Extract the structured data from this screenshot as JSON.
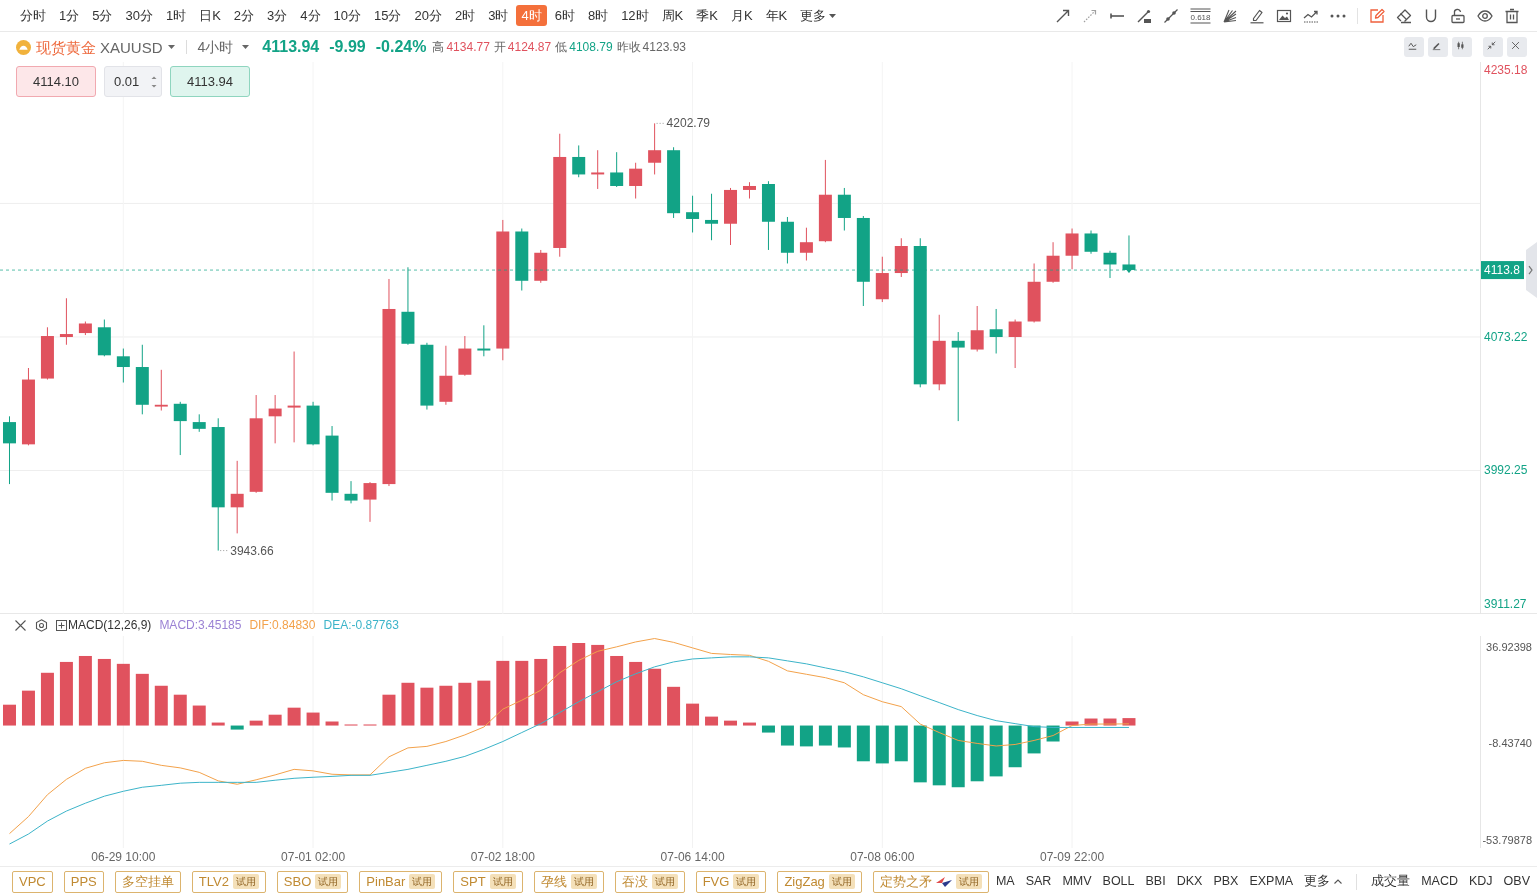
{
  "toolbar": {
    "intervals": [
      {
        "label": "分时",
        "selected": false
      },
      {
        "label": "1分",
        "selected": false
      },
      {
        "label": "5分",
        "selected": false
      },
      {
        "label": "30分",
        "selected": false
      },
      {
        "label": "1时",
        "selected": false
      },
      {
        "label": "日K",
        "selected": false
      },
      {
        "label": "2分",
        "selected": false
      },
      {
        "label": "3分",
        "selected": false
      },
      {
        "label": "4分",
        "selected": false
      },
      {
        "label": "10分",
        "selected": false
      },
      {
        "label": "15分",
        "selected": false
      },
      {
        "label": "20分",
        "selected": false
      },
      {
        "label": "2时",
        "selected": false
      },
      {
        "label": "3时",
        "selected": false
      },
      {
        "label": "4时",
        "selected": true
      },
      {
        "label": "6时",
        "selected": false
      },
      {
        "label": "8时",
        "selected": false
      },
      {
        "label": "12时",
        "selected": false
      },
      {
        "label": "周K",
        "selected": false
      },
      {
        "label": "季K",
        "selected": false
      },
      {
        "label": "月K",
        "selected": false
      },
      {
        "label": "年K",
        "selected": false
      }
    ],
    "more": "更多",
    "drawing_tools": [
      {
        "selected": false
      },
      {
        "selected": false
      },
      {
        "selected": false
      },
      {
        "selected": false
      },
      {
        "selected": false
      },
      {
        "selected": false,
        "label": "0.618"
      },
      {
        "selected": false
      },
      {
        "selected": false
      },
      {
        "selected": false
      },
      {
        "selected": false
      }
    ],
    "edit_tools": [
      {
        "selected": true
      },
      {
        "selected": false
      },
      {
        "selected": false
      },
      {
        "selected": false
      },
      {
        "selected": false
      },
      {
        "selected": false
      }
    ]
  },
  "header": {
    "symbol": {
      "name": "现货黄金",
      "code": "XAUUSD"
    },
    "period": "4小时",
    "quote": {
      "price": "4113.94",
      "change": "-9.99",
      "change_percent": "-0.24%",
      "rising": false
    },
    "stats": [
      {
        "label": "高",
        "value": "4134.77",
        "color": "#e0525e"
      },
      {
        "label": "开",
        "value": "4124.87",
        "color": "#e0525e"
      },
      {
        "label": "低",
        "value": "4108.79",
        "color": "#12a386"
      },
      {
        "label": "昨收",
        "value": "4123.93",
        "color": "#666666"
      }
    ]
  },
  "trade": {
    "sell_price": "4114.10",
    "lot": "0.01",
    "buy_price": "4113.94"
  },
  "chart": {
    "chart_data": [
      {
        "type": "candlestick",
        "ylim": [
          3905.2,
          4240.0
        ],
        "yticks": [
          4235.18,
          4073.22,
          3992.25,
          3911.27
        ],
        "grid": true,
        "annotations": [
          "4202.79",
          "3943.66"
        ],
        "ref_lines": [
          {
            "axis": "y",
            "value": 4113.8,
            "label": "4113.8",
            "color": "#12a386",
            "line_style": "dashed"
          }
        ],
        "ohlc": [
          [
            4021.6,
            4025.1,
            3984.0,
            4008.7
          ],
          [
            4008.1,
            4054.4,
            4007.5,
            4047.4
          ],
          [
            4048.0,
            4079.1,
            4047.4,
            4073.8
          ],
          [
            4073.2,
            4096.7,
            4068.5,
            4075.0
          ],
          [
            4075.6,
            4082.6,
            4074.4,
            4081.4
          ],
          [
            4079.1,
            4083.8,
            4061.5,
            4062.1
          ],
          [
            4061.5,
            4066.2,
            4045.6,
            4055.0
          ],
          [
            4055.0,
            4068.5,
            4026.3,
            4032.1
          ],
          [
            4031.0,
            4053.3,
            4028.6,
            4032.1
          ],
          [
            4032.7,
            4033.9,
            4001.6,
            4022.2
          ],
          [
            4021.6,
            4026.3,
            4015.7,
            4017.5
          ],
          [
            4018.6,
            4023.9,
            3943.66,
            3969.9
          ],
          [
            3969.9,
            3998.1,
            3954.1,
            3978.1
          ],
          [
            3979.3,
            4038.0,
            3978.7,
            4023.9
          ],
          [
            4025.1,
            4038.0,
            4008.7,
            4029.8
          ],
          [
            4030.4,
            4064.4,
            4009.3,
            4031.6
          ],
          [
            4031.6,
            4033.9,
            4007.5,
            4008.1
          ],
          [
            4013.4,
            4019.2,
            3974.0,
            3978.7
          ],
          [
            3978.1,
            3985.8,
            3972.3,
            3974.0
          ],
          [
            3974.6,
            3985.2,
            3961.1,
            3984.6
          ],
          [
            3984.0,
            4108.4,
            3982.8,
            4090.2
          ],
          [
            4088.5,
            4115.5,
            4068.5,
            4069.1
          ],
          [
            4068.5,
            4069.7,
            4029.2,
            4031.6
          ],
          [
            4033.9,
            4067.9,
            4032.1,
            4049.7
          ],
          [
            4050.3,
            4073.8,
            4049.7,
            4066.2
          ],
          [
            4066.2,
            4080.3,
            4061.5,
            4065.0
          ],
          [
            4066.2,
            4144.2,
            4059.1,
            4137.2
          ],
          [
            4137.2,
            4139.0,
            4101.4,
            4107.3
          ],
          [
            4107.3,
            4126.0,
            4106.1,
            4124.3
          ],
          [
            4127.2,
            4196.5,
            4121.9,
            4182.4
          ],
          [
            4182.4,
            4189.4,
            4170.1,
            4171.8
          ],
          [
            4171.8,
            4186.5,
            4163.0,
            4173.0
          ],
          [
            4173.0,
            4185.3,
            4164.2,
            4164.8
          ],
          [
            4164.8,
            4178.9,
            4157.2,
            4175.3
          ],
          [
            4178.9,
            4202.79,
            4171.8,
            4186.5
          ],
          [
            4186.5,
            4188.3,
            4145.4,
            4148.3
          ],
          [
            4148.9,
            4158.9,
            4136.6,
            4144.8
          ],
          [
            4144.2,
            4160.1,
            4131.9,
            4141.9
          ],
          [
            4141.9,
            4163.6,
            4129.0,
            4162.4
          ],
          [
            4162.4,
            4167.1,
            4157.2,
            4164.8
          ],
          [
            4166.0,
            4167.7,
            4126.0,
            4143.1
          ],
          [
            4143.1,
            4146.0,
            4117.8,
            4124.3
          ],
          [
            4124.3,
            4139.5,
            4119.6,
            4130.7
          ],
          [
            4131.3,
            4180.6,
            4130.7,
            4159.5
          ],
          [
            4159.5,
            4163.6,
            4137.8,
            4145.4
          ],
          [
            4145.4,
            4146.6,
            4092.0,
            4106.7
          ],
          [
            4096.1,
            4121.9,
            4094.4,
            4112.0
          ],
          [
            4112.0,
            4133.1,
            4109.6,
            4128.4
          ],
          [
            4128.4,
            4133.1,
            4042.7,
            4044.5
          ],
          [
            4044.5,
            4086.7,
            4040.9,
            4070.9
          ],
          [
            4070.9,
            4076.2,
            4022.2,
            4066.8
          ],
          [
            4065.6,
            4092.0,
            4064.4,
            4077.3
          ],
          [
            4077.9,
            4090.2,
            4063.2,
            4073.2
          ],
          [
            4073.2,
            4083.8,
            4054.4,
            4082.6
          ],
          [
            4082.6,
            4117.8,
            4082.0,
            4106.7
          ],
          [
            4106.7,
            4130.7,
            4106.1,
            4122.5
          ],
          [
            4122.5,
            4139.0,
            4114.3,
            4136.0
          ],
          [
            4136.0,
            4137.8,
            4123.7,
            4124.9
          ],
          [
            4124.3,
            4125.5,
            4109.0,
            4117.2
          ],
          [
            4117.2,
            4134.8,
            4112.5,
            4113.87
          ],
          null,
          null,
          null,
          null,
          null,
          null,
          null,
          null,
          null,
          null,
          null,
          null,
          null,
          null,
          null,
          null,
          null,
          null
        ]
      },
      {
        "type": "bar",
        "title": "MACD(12,26,9)",
        "ylim": [
          -57.56,
          42.09
        ],
        "grid": true,
        "yticks": [
          {
            "value": 36.92398,
            "label": "36.92398"
          },
          {
            "value": -8.4374,
            "label": "-8.43740"
          },
          {
            "value": -53.79878,
            "label": "-53.79878"
          }
        ],
        "categories": [
          null,
          null,
          null,
          null,
          null,
          null,
          "06-29 10:00",
          null,
          null,
          null,
          null,
          null,
          null,
          null,
          null,
          null,
          "07-01 02:00",
          null,
          null,
          null,
          null,
          null,
          null,
          null,
          null,
          null,
          "07-02 18:00",
          null,
          null,
          null,
          null,
          null,
          null,
          null,
          null,
          null,
          "07-06 14:00",
          null,
          null,
          null,
          null,
          null,
          null,
          null,
          null,
          null,
          "07-08 06:00",
          null,
          null,
          null,
          null,
          null,
          null,
          null,
          null,
          null,
          "07-09 22:00",
          null,
          null,
          null,
          null,
          null,
          null,
          null,
          null,
          null,
          null,
          null,
          null,
          null,
          null,
          null,
          null,
          null,
          null,
          null,
          null,
          null
        ],
        "series": [
          {
            "values": [
              9.8,
              16.4,
              24.8,
              29.9,
              32.7,
              31.3,
              29.0,
              24.3,
              18.7,
              14.5,
              9.4,
              1.4,
              -1.9,
              2.3,
              5.1,
              8.4,
              6.1,
              1.9,
              0.5,
              0.5,
              14.5,
              20.1,
              17.8,
              18.7,
              20.1,
              21.1,
              30.4,
              30.4,
              31.3,
              37.4,
              38.8,
              37.9,
              32.7,
              29.9,
              26.7,
              18.2,
              10.3,
              4.2,
              2.3,
              1.4,
              -3.3,
              -9.4,
              -9.8,
              -9.4,
              -10.3,
              -16.8,
              -17.8,
              -16.8,
              -26.7,
              -28.1,
              -29.0,
              -26.2,
              -23.9,
              -19.6,
              -13.1,
              -7.5,
              1.9,
              3.3,
              3.3,
              3.5,
              null,
              null,
              null,
              null,
              null,
              null,
              null,
              null,
              null,
              null,
              null,
              null,
              null,
              null,
              null,
              null,
              null,
              null
            ],
            "colors": [
              "#e0525e",
              "#e0525e",
              "#e0525e",
              "#e0525e",
              "#e0525e",
              "#e0525e",
              "#e0525e",
              "#e0525e",
              "#e0525e",
              "#e0525e",
              "#e0525e",
              "#e0525e",
              "#12a386",
              "#e0525e",
              "#e0525e",
              "#e0525e",
              "#e0525e",
              "#e0525e",
              "#e0525e",
              "#e0525e",
              "#e0525e",
              "#e0525e",
              "#e0525e",
              "#e0525e",
              "#e0525e",
              "#e0525e",
              "#e0525e",
              "#e0525e",
              "#e0525e",
              "#e0525e",
              "#e0525e",
              "#e0525e",
              "#e0525e",
              "#e0525e",
              "#e0525e",
              "#e0525e",
              "#e0525e",
              "#e0525e",
              "#e0525e",
              "#e0525e",
              "#12a386",
              "#12a386",
              "#12a386",
              "#12a386",
              "#12a386",
              "#12a386",
              "#12a386",
              "#12a386",
              "#12a386",
              "#12a386",
              "#12a386",
              "#12a386",
              "#12a386",
              "#12a386",
              "#12a386",
              "#12a386",
              "#e0525e",
              "#e0525e",
              "#e0525e",
              "#e0525e",
              null,
              null,
              null,
              null,
              null,
              null,
              null,
              null,
              null,
              null,
              null,
              null,
              null,
              null,
              null,
              null,
              null,
              null
            ]
          },
          {
            "type": "line",
            "color": "#f3a24b",
            "values": [
              -50.8,
              -42.8,
              -32.5,
              -25.3,
              -20.1,
              -17.5,
              -16.4,
              -16.8,
              -18.7,
              -19.9,
              -22.0,
              -26.0,
              -27.6,
              -25.5,
              -23.2,
              -20.6,
              -21.3,
              -22.9,
              -23.2,
              -23.2,
              -14.7,
              -10.5,
              -9.8,
              -7.5,
              -4.4,
              -0.7,
              7.7,
              11.9,
              16.6,
              24.8,
              30.6,
              34.9,
              37.0,
              39.3,
              40.9,
              39.1,
              36.5,
              33.9,
              33.4,
              33.0,
              30.2,
              25.7,
              24.1,
              22.5,
              20.1,
              14.5,
              11.2,
              8.9,
              0.7,
              -3.3,
              -7.0,
              -8.4,
              -9.6,
              -8.9,
              -7.0,
              -4.7,
              0.0,
              0.7,
              0.7,
              0.8,
              null,
              null,
              null,
              null,
              null,
              null,
              null,
              null,
              null,
              null,
              null,
              null,
              null,
              null,
              null,
              null,
              null,
              null
            ]
          },
          {
            "type": "line",
            "color": "#3cb4c9",
            "values": [
              -55.7,
              -51.0,
              -44.9,
              -40.2,
              -36.5,
              -33.2,
              -30.9,
              -29.0,
              -28.1,
              -27.1,
              -26.7,
              -26.7,
              -26.7,
              -26.7,
              -25.7,
              -24.8,
              -24.3,
              -23.9,
              -23.4,
              -23.4,
              -22.0,
              -20.6,
              -18.7,
              -16.8,
              -14.5,
              -11.2,
              -7.5,
              -3.3,
              0.9,
              6.1,
              11.2,
              15.9,
              20.6,
              24.3,
              27.6,
              29.9,
              31.3,
              31.8,
              32.3,
              32.3,
              31.8,
              30.4,
              29.0,
              27.1,
              25.3,
              22.9,
              20.1,
              17.3,
              14.0,
              10.8,
              7.5,
              4.7,
              2.3,
              0.9,
              -0.5,
              -0.9,
              -0.9,
              -0.9,
              -0.9,
              -0.9,
              null,
              null,
              null,
              null,
              null,
              null,
              null,
              null,
              null,
              null,
              null,
              null,
              null,
              null,
              null,
              null,
              null,
              null
            ]
          }
        ]
      }
    ],
    "macd_legend": [
      {
        "text": "MACD:3.45185",
        "color": "#9b82d4"
      },
      {
        "text": "DIF:0.84830",
        "color": "#f3a24b"
      },
      {
        "text": "DEA:-0.87763",
        "color": "#3cb4c9"
      }
    ]
  },
  "bottom_bar": {
    "signals": [
      {
        "label": "VPC"
      },
      {
        "label": "PPS"
      },
      {
        "label": "多空挂单"
      },
      {
        "label": "TLV2",
        "badge": "试用"
      },
      {
        "label": "SBO",
        "badge": "试用"
      },
      {
        "label": "PinBar",
        "badge": "试用"
      },
      {
        "label": "SPT",
        "badge": "试用"
      },
      {
        "label": "孕线",
        "badge": "试用"
      },
      {
        "label": "吞没",
        "badge": "试用"
      },
      {
        "label": "FVG",
        "badge": "试用"
      },
      {
        "label": "ZigZag",
        "badge": "试用"
      },
      {
        "label": "定势之矛",
        "badge": "试用",
        "has_icon": true
      }
    ],
    "indicators": [
      "MA",
      "SAR",
      "MMV",
      "BOLL",
      "BBI",
      "DKX",
      "PBX",
      "EXPMA"
    ],
    "more": "更多",
    "sub_indicators": [
      "成交量",
      "MACD",
      "KDJ",
      "OBV"
    ]
  }
}
